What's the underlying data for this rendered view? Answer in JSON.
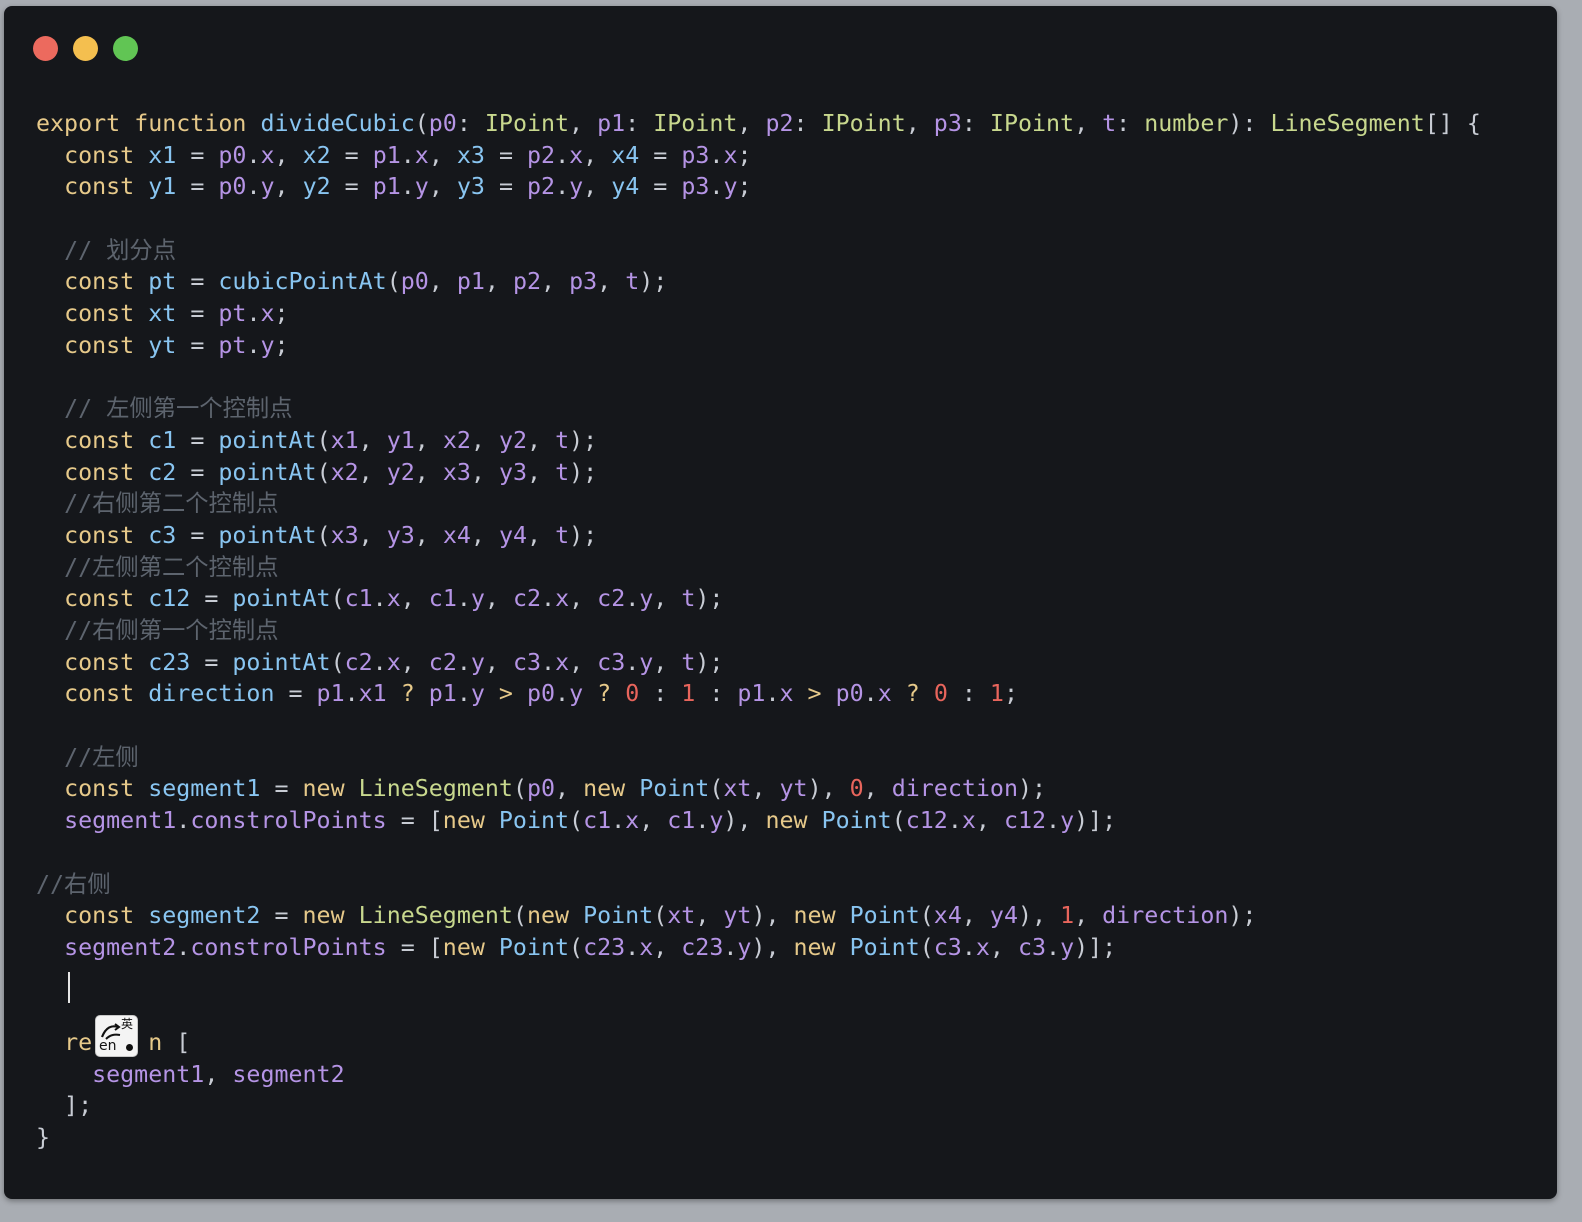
{
  "window": {
    "traffic_lights": [
      {
        "name": "close",
        "color": "#ec6a5e"
      },
      {
        "name": "minimize",
        "color": "#f4bf4f"
      },
      {
        "name": "maximize",
        "color": "#61c554"
      }
    ]
  },
  "colors": {
    "background": "#15171b",
    "keyword": "#e6c98a",
    "function": "#89c5f1",
    "type": "#c8d88e",
    "identifier": "#b594e5",
    "number": "#e8655c",
    "comment": "#5d646e"
  },
  "ime_indicator": {
    "icon": "input-method-icon",
    "zh_label": "英",
    "en_label": "en"
  },
  "code_lines": [
    [
      [
        "kw",
        "export"
      ],
      [
        "pu",
        " "
      ],
      [
        "kw",
        "function"
      ],
      [
        "pu",
        " "
      ],
      [
        "fn",
        "divideCubic"
      ],
      [
        "pu",
        "("
      ],
      [
        "id",
        "p0"
      ],
      [
        "pu",
        ": "
      ],
      [
        "ty",
        "IPoint"
      ],
      [
        "pu",
        ", "
      ],
      [
        "id",
        "p1"
      ],
      [
        "pu",
        ": "
      ],
      [
        "ty",
        "IPoint"
      ],
      [
        "pu",
        ", "
      ],
      [
        "id",
        "p2"
      ],
      [
        "pu",
        ": "
      ],
      [
        "ty",
        "IPoint"
      ],
      [
        "pu",
        ", "
      ],
      [
        "id",
        "p3"
      ],
      [
        "pu",
        ": "
      ],
      [
        "ty",
        "IPoint"
      ],
      [
        "pu",
        ", "
      ],
      [
        "id",
        "t"
      ],
      [
        "pu",
        ": "
      ],
      [
        "ty",
        "number"
      ],
      [
        "pu",
        "): "
      ],
      [
        "ty",
        "LineSegment"
      ],
      [
        "pu",
        "[] {"
      ]
    ],
    [
      [
        "pu",
        "  "
      ],
      [
        "kw",
        "const"
      ],
      [
        "pu",
        " "
      ],
      [
        "fn",
        "x1"
      ],
      [
        "op",
        " = "
      ],
      [
        "id",
        "p0"
      ],
      [
        "pu",
        "."
      ],
      [
        "id",
        "x"
      ],
      [
        "pu",
        ", "
      ],
      [
        "fn",
        "x2"
      ],
      [
        "op",
        " = "
      ],
      [
        "id",
        "p1"
      ],
      [
        "pu",
        "."
      ],
      [
        "id",
        "x"
      ],
      [
        "pu",
        ", "
      ],
      [
        "fn",
        "x3"
      ],
      [
        "op",
        " = "
      ],
      [
        "id",
        "p2"
      ],
      [
        "pu",
        "."
      ],
      [
        "id",
        "x"
      ],
      [
        "pu",
        ", "
      ],
      [
        "fn",
        "x4"
      ],
      [
        "op",
        " = "
      ],
      [
        "id",
        "p3"
      ],
      [
        "pu",
        "."
      ],
      [
        "id",
        "x"
      ],
      [
        "pu",
        ";"
      ]
    ],
    [
      [
        "pu",
        "  "
      ],
      [
        "kw",
        "const"
      ],
      [
        "pu",
        " "
      ],
      [
        "fn",
        "y1"
      ],
      [
        "op",
        " = "
      ],
      [
        "id",
        "p0"
      ],
      [
        "pu",
        "."
      ],
      [
        "id",
        "y"
      ],
      [
        "pu",
        ", "
      ],
      [
        "fn",
        "y2"
      ],
      [
        "op",
        " = "
      ],
      [
        "id",
        "p1"
      ],
      [
        "pu",
        "."
      ],
      [
        "id",
        "y"
      ],
      [
        "pu",
        ", "
      ],
      [
        "fn",
        "y3"
      ],
      [
        "op",
        " = "
      ],
      [
        "id",
        "p2"
      ],
      [
        "pu",
        "."
      ],
      [
        "id",
        "y"
      ],
      [
        "pu",
        ", "
      ],
      [
        "fn",
        "y4"
      ],
      [
        "op",
        " = "
      ],
      [
        "id",
        "p3"
      ],
      [
        "pu",
        "."
      ],
      [
        "id",
        "y"
      ],
      [
        "pu",
        ";"
      ]
    ],
    [],
    [
      [
        "pu",
        "  "
      ],
      [
        "cm",
        "// 划分点"
      ]
    ],
    [
      [
        "pu",
        "  "
      ],
      [
        "kw",
        "const"
      ],
      [
        "pu",
        " "
      ],
      [
        "fn",
        "pt"
      ],
      [
        "op",
        " = "
      ],
      [
        "fn",
        "cubicPointAt"
      ],
      [
        "pu",
        "("
      ],
      [
        "id",
        "p0"
      ],
      [
        "pu",
        ", "
      ],
      [
        "id",
        "p1"
      ],
      [
        "pu",
        ", "
      ],
      [
        "id",
        "p2"
      ],
      [
        "pu",
        ", "
      ],
      [
        "id",
        "p3"
      ],
      [
        "pu",
        ", "
      ],
      [
        "id",
        "t"
      ],
      [
        "pu",
        ");"
      ]
    ],
    [
      [
        "pu",
        "  "
      ],
      [
        "kw",
        "const"
      ],
      [
        "pu",
        " "
      ],
      [
        "fn",
        "xt"
      ],
      [
        "op",
        " = "
      ],
      [
        "id",
        "pt"
      ],
      [
        "pu",
        "."
      ],
      [
        "id",
        "x"
      ],
      [
        "pu",
        ";"
      ]
    ],
    [
      [
        "pu",
        "  "
      ],
      [
        "kw",
        "const"
      ],
      [
        "pu",
        " "
      ],
      [
        "fn",
        "yt"
      ],
      [
        "op",
        " = "
      ],
      [
        "id",
        "pt"
      ],
      [
        "pu",
        "."
      ],
      [
        "id",
        "y"
      ],
      [
        "pu",
        ";"
      ]
    ],
    [],
    [
      [
        "pu",
        "  "
      ],
      [
        "cm",
        "// 左侧第一个控制点"
      ]
    ],
    [
      [
        "pu",
        "  "
      ],
      [
        "kw",
        "const"
      ],
      [
        "pu",
        " "
      ],
      [
        "fn",
        "c1"
      ],
      [
        "op",
        " = "
      ],
      [
        "fn",
        "pointAt"
      ],
      [
        "pu",
        "("
      ],
      [
        "id",
        "x1"
      ],
      [
        "pu",
        ", "
      ],
      [
        "id",
        "y1"
      ],
      [
        "pu",
        ", "
      ],
      [
        "id",
        "x2"
      ],
      [
        "pu",
        ", "
      ],
      [
        "id",
        "y2"
      ],
      [
        "pu",
        ", "
      ],
      [
        "id",
        "t"
      ],
      [
        "pu",
        ");"
      ]
    ],
    [
      [
        "pu",
        "  "
      ],
      [
        "kw",
        "const"
      ],
      [
        "pu",
        " "
      ],
      [
        "fn",
        "c2"
      ],
      [
        "op",
        " = "
      ],
      [
        "fn",
        "pointAt"
      ],
      [
        "pu",
        "("
      ],
      [
        "id",
        "x2"
      ],
      [
        "pu",
        ", "
      ],
      [
        "id",
        "y2"
      ],
      [
        "pu",
        ", "
      ],
      [
        "id",
        "x3"
      ],
      [
        "pu",
        ", "
      ],
      [
        "id",
        "y3"
      ],
      [
        "pu",
        ", "
      ],
      [
        "id",
        "t"
      ],
      [
        "pu",
        ");"
      ]
    ],
    [
      [
        "pu",
        "  "
      ],
      [
        "cm",
        "//右侧第二个控制点"
      ]
    ],
    [
      [
        "pu",
        "  "
      ],
      [
        "kw",
        "const"
      ],
      [
        "pu",
        " "
      ],
      [
        "fn",
        "c3"
      ],
      [
        "op",
        " = "
      ],
      [
        "fn",
        "pointAt"
      ],
      [
        "pu",
        "("
      ],
      [
        "id",
        "x3"
      ],
      [
        "pu",
        ", "
      ],
      [
        "id",
        "y3"
      ],
      [
        "pu",
        ", "
      ],
      [
        "id",
        "x4"
      ],
      [
        "pu",
        ", "
      ],
      [
        "id",
        "y4"
      ],
      [
        "pu",
        ", "
      ],
      [
        "id",
        "t"
      ],
      [
        "pu",
        ");"
      ]
    ],
    [
      [
        "pu",
        "  "
      ],
      [
        "cm",
        "//左侧第二个控制点"
      ]
    ],
    [
      [
        "pu",
        "  "
      ],
      [
        "kw",
        "const"
      ],
      [
        "pu",
        " "
      ],
      [
        "fn",
        "c12"
      ],
      [
        "op",
        " = "
      ],
      [
        "fn",
        "pointAt"
      ],
      [
        "pu",
        "("
      ],
      [
        "id",
        "c1"
      ],
      [
        "pu",
        "."
      ],
      [
        "id",
        "x"
      ],
      [
        "pu",
        ", "
      ],
      [
        "id",
        "c1"
      ],
      [
        "pu",
        "."
      ],
      [
        "id",
        "y"
      ],
      [
        "pu",
        ", "
      ],
      [
        "id",
        "c2"
      ],
      [
        "pu",
        "."
      ],
      [
        "id",
        "x"
      ],
      [
        "pu",
        ", "
      ],
      [
        "id",
        "c2"
      ],
      [
        "pu",
        "."
      ],
      [
        "id",
        "y"
      ],
      [
        "pu",
        ", "
      ],
      [
        "id",
        "t"
      ],
      [
        "pu",
        ");"
      ]
    ],
    [
      [
        "pu",
        "  "
      ],
      [
        "cm",
        "//右侧第一个控制点"
      ]
    ],
    [
      [
        "pu",
        "  "
      ],
      [
        "kw",
        "const"
      ],
      [
        "pu",
        " "
      ],
      [
        "fn",
        "c23"
      ],
      [
        "op",
        " = "
      ],
      [
        "fn",
        "pointAt"
      ],
      [
        "pu",
        "("
      ],
      [
        "id",
        "c2"
      ],
      [
        "pu",
        "."
      ],
      [
        "id",
        "x"
      ],
      [
        "pu",
        ", "
      ],
      [
        "id",
        "c2"
      ],
      [
        "pu",
        "."
      ],
      [
        "id",
        "y"
      ],
      [
        "pu",
        ", "
      ],
      [
        "id",
        "c3"
      ],
      [
        "pu",
        "."
      ],
      [
        "id",
        "x"
      ],
      [
        "pu",
        ", "
      ],
      [
        "id",
        "c3"
      ],
      [
        "pu",
        "."
      ],
      [
        "id",
        "y"
      ],
      [
        "pu",
        ", "
      ],
      [
        "id",
        "t"
      ],
      [
        "pu",
        ");"
      ]
    ],
    [
      [
        "pu",
        "  "
      ],
      [
        "kw",
        "const"
      ],
      [
        "pu",
        " "
      ],
      [
        "fn",
        "direction"
      ],
      [
        "op",
        " = "
      ],
      [
        "id",
        "p1"
      ],
      [
        "pu",
        "."
      ],
      [
        "id",
        "x1"
      ],
      [
        "kw",
        " ? "
      ],
      [
        "id",
        "p1"
      ],
      [
        "pu",
        "."
      ],
      [
        "id",
        "y"
      ],
      [
        "kw",
        " > "
      ],
      [
        "id",
        "p0"
      ],
      [
        "pu",
        "."
      ],
      [
        "id",
        "y"
      ],
      [
        "kw",
        " ? "
      ],
      [
        "nu",
        "0"
      ],
      [
        "pu",
        " : "
      ],
      [
        "nu",
        "1"
      ],
      [
        "pu",
        " : "
      ],
      [
        "id",
        "p1"
      ],
      [
        "pu",
        "."
      ],
      [
        "id",
        "x"
      ],
      [
        "kw",
        " > "
      ],
      [
        "id",
        "p0"
      ],
      [
        "pu",
        "."
      ],
      [
        "id",
        "x"
      ],
      [
        "kw",
        " ? "
      ],
      [
        "nu",
        "0"
      ],
      [
        "pu",
        " : "
      ],
      [
        "nu",
        "1"
      ],
      [
        "pu",
        ";"
      ]
    ],
    [],
    [
      [
        "pu",
        "  "
      ],
      [
        "cm",
        "//左侧"
      ]
    ],
    [
      [
        "pu",
        "  "
      ],
      [
        "kw",
        "const"
      ],
      [
        "pu",
        " "
      ],
      [
        "fn",
        "segment1"
      ],
      [
        "op",
        " = "
      ],
      [
        "kw",
        "new"
      ],
      [
        "pu",
        " "
      ],
      [
        "ty",
        "LineSegment"
      ],
      [
        "pu",
        "("
      ],
      [
        "id",
        "p0"
      ],
      [
        "pu",
        ", "
      ],
      [
        "kw",
        "new"
      ],
      [
        "pu",
        " "
      ],
      [
        "fn",
        "Point"
      ],
      [
        "pu",
        "("
      ],
      [
        "id",
        "xt"
      ],
      [
        "pu",
        ", "
      ],
      [
        "id",
        "yt"
      ],
      [
        "pu",
        "), "
      ],
      [
        "nu",
        "0"
      ],
      [
        "pu",
        ", "
      ],
      [
        "id",
        "direction"
      ],
      [
        "pu",
        ");"
      ]
    ],
    [
      [
        "pu",
        "  "
      ],
      [
        "id",
        "segment1"
      ],
      [
        "pu",
        "."
      ],
      [
        "id",
        "constrolPoints"
      ],
      [
        "op",
        " = "
      ],
      [
        "pu",
        "["
      ],
      [
        "kw",
        "new"
      ],
      [
        "pu",
        " "
      ],
      [
        "fn",
        "Point"
      ],
      [
        "pu",
        "("
      ],
      [
        "id",
        "c1"
      ],
      [
        "pu",
        "."
      ],
      [
        "id",
        "x"
      ],
      [
        "pu",
        ", "
      ],
      [
        "id",
        "c1"
      ],
      [
        "pu",
        "."
      ],
      [
        "id",
        "y"
      ],
      [
        "pu",
        "), "
      ],
      [
        "kw",
        "new"
      ],
      [
        "pu",
        " "
      ],
      [
        "fn",
        "Point"
      ],
      [
        "pu",
        "("
      ],
      [
        "id",
        "c12"
      ],
      [
        "pu",
        "."
      ],
      [
        "id",
        "x"
      ],
      [
        "pu",
        ", "
      ],
      [
        "id",
        "c12"
      ],
      [
        "pu",
        "."
      ],
      [
        "id",
        "y"
      ],
      [
        "pu",
        ")];"
      ]
    ],
    [],
    [
      [
        "cm",
        "//右侧"
      ]
    ],
    [
      [
        "pu",
        "  "
      ],
      [
        "kw",
        "const"
      ],
      [
        "pu",
        " "
      ],
      [
        "fn",
        "segment2"
      ],
      [
        "op",
        " = "
      ],
      [
        "kw",
        "new"
      ],
      [
        "pu",
        " "
      ],
      [
        "ty",
        "LineSegment"
      ],
      [
        "pu",
        "("
      ],
      [
        "kw",
        "new"
      ],
      [
        "pu",
        " "
      ],
      [
        "fn",
        "Point"
      ],
      [
        "pu",
        "("
      ],
      [
        "id",
        "xt"
      ],
      [
        "pu",
        ", "
      ],
      [
        "id",
        "yt"
      ],
      [
        "pu",
        "), "
      ],
      [
        "kw",
        "new"
      ],
      [
        "pu",
        " "
      ],
      [
        "fn",
        "Point"
      ],
      [
        "pu",
        "("
      ],
      [
        "id",
        "x4"
      ],
      [
        "pu",
        ", "
      ],
      [
        "id",
        "y4"
      ],
      [
        "pu",
        "), "
      ],
      [
        "nu",
        "1"
      ],
      [
        "pu",
        ", "
      ],
      [
        "id",
        "direction"
      ],
      [
        "pu",
        ");"
      ]
    ],
    [
      [
        "pu",
        "  "
      ],
      [
        "id",
        "segment2"
      ],
      [
        "pu",
        "."
      ],
      [
        "id",
        "constrolPoints"
      ],
      [
        "op",
        " = "
      ],
      [
        "pu",
        "["
      ],
      [
        "kw",
        "new"
      ],
      [
        "pu",
        " "
      ],
      [
        "fn",
        "Point"
      ],
      [
        "pu",
        "("
      ],
      [
        "id",
        "c23"
      ],
      [
        "pu",
        "."
      ],
      [
        "id",
        "x"
      ],
      [
        "pu",
        ", "
      ],
      [
        "id",
        "c23"
      ],
      [
        "pu",
        "."
      ],
      [
        "id",
        "y"
      ],
      [
        "pu",
        "), "
      ],
      [
        "kw",
        "new"
      ],
      [
        "pu",
        " "
      ],
      [
        "fn",
        "Point"
      ],
      [
        "pu",
        "("
      ],
      [
        "id",
        "c3"
      ],
      [
        "pu",
        "."
      ],
      [
        "id",
        "x"
      ],
      [
        "pu",
        ", "
      ],
      [
        "id",
        "c3"
      ],
      [
        "pu",
        "."
      ],
      [
        "id",
        "y"
      ],
      [
        "pu",
        ")];"
      ]
    ],
    [],
    [],
    [
      [
        "pu",
        "  "
      ],
      [
        "kw",
        "re"
      ],
      [
        "pu",
        "    "
      ],
      [
        "kw",
        "n"
      ],
      [
        "pu",
        " ["
      ]
    ],
    [
      [
        "pu",
        "    "
      ],
      [
        "id",
        "segment1"
      ],
      [
        "pu",
        ", "
      ],
      [
        "id",
        "segment2"
      ]
    ],
    [
      [
        "pu",
        "  ];"
      ]
    ],
    [
      [
        "pu",
        "}"
      ]
    ]
  ]
}
